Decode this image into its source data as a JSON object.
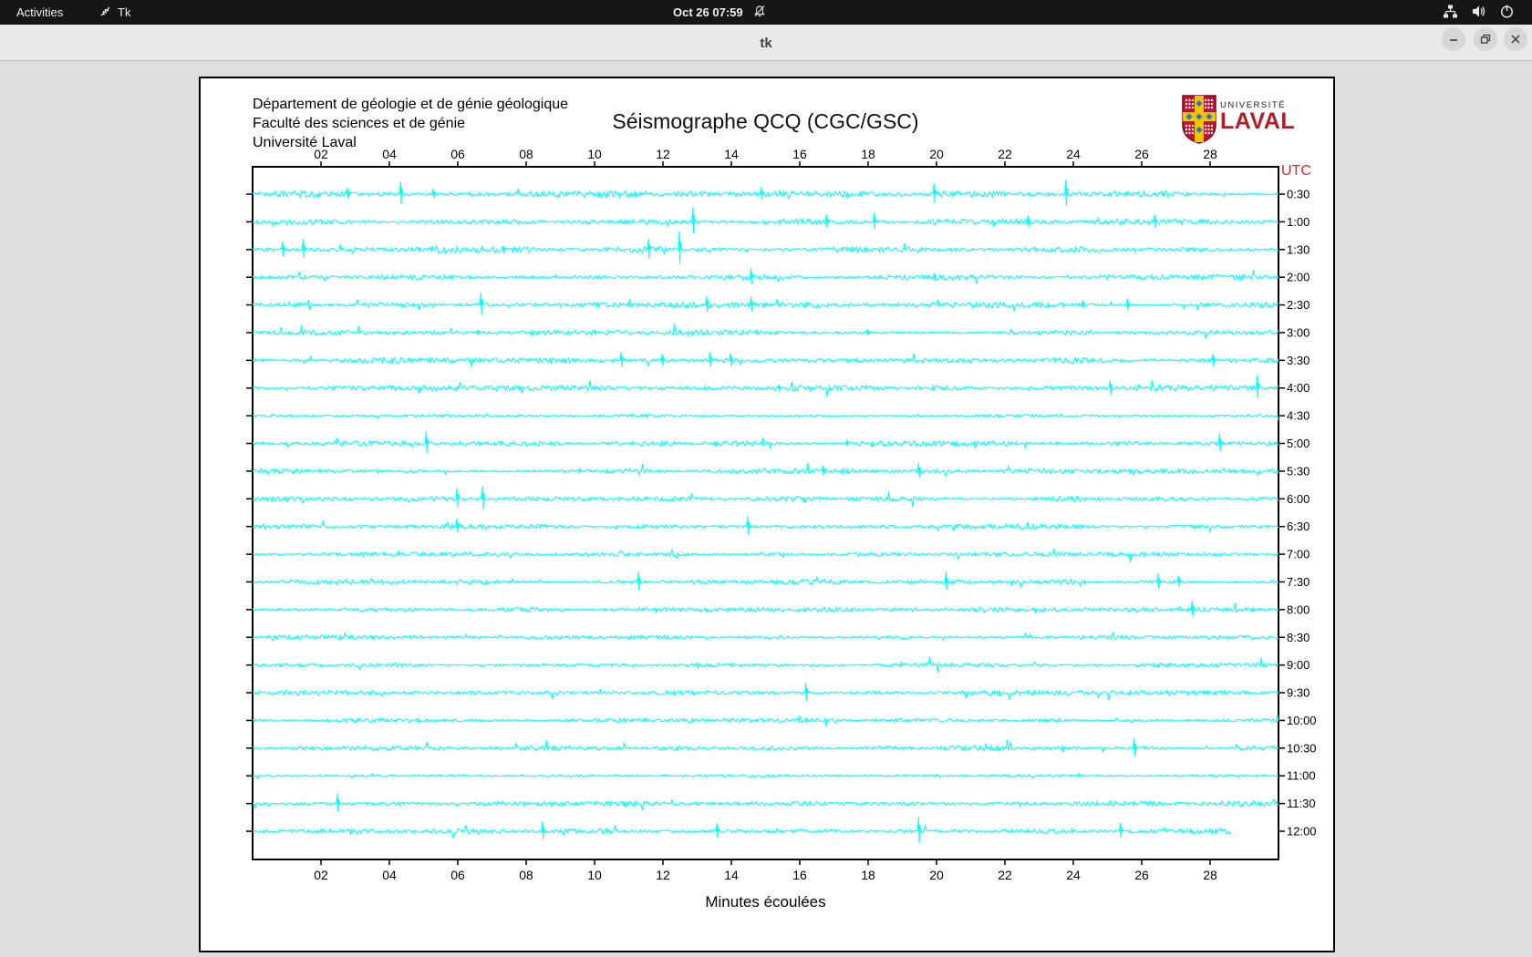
{
  "top_bar": {
    "activities": "Activities",
    "app_name": "Tk",
    "clock": "Oct 26  07:59"
  },
  "window": {
    "title": "tk"
  },
  "icons": {
    "top_bar_left": [
      "tk-app-icon"
    ],
    "top_bar_center": [
      "bell-slash-icon"
    ],
    "top_bar_right": [
      "network-icon",
      "volume-icon",
      "power-icon"
    ],
    "title_bar": [
      "minimize-icon",
      "restore-icon",
      "close-icon"
    ]
  },
  "canvas": {
    "header": {
      "line1": "Département de géologie et de génie géologique",
      "line2": "Faculté des sciences et de génie",
      "line3": "Université Laval"
    },
    "logo": {
      "line1": "UNIVERSITÉ",
      "line2": "LAVAL",
      "red": "#b01f27"
    }
  },
  "chart_data": {
    "type": "line",
    "title": "Séismographe QCQ (CGC/GSC)",
    "xlabel": "Minutes écoulées",
    "right_axis_label": "UTC",
    "x_range_minutes": [
      0,
      30
    ],
    "x_ticks": [
      "02",
      "04",
      "06",
      "08",
      "10",
      "12",
      "14",
      "16",
      "18",
      "20",
      "22",
      "24",
      "26",
      "28"
    ],
    "grid": false,
    "trace_color": "#00ffff",
    "axis_color": "#000000",
    "utc_color": "#e82222",
    "rows": [
      {
        "label": "0:30",
        "amp": 2.0,
        "spikes": [
          [
            2.8,
            7
          ],
          [
            4.35,
            14
          ],
          [
            5.3,
            6
          ],
          [
            14.9,
            8
          ],
          [
            19.95,
            12
          ],
          [
            23.8,
            16
          ]
        ]
      },
      {
        "label": "1:00",
        "amp": 1.8,
        "spikes": [
          [
            12.9,
            16
          ],
          [
            16.8,
            8
          ],
          [
            18.2,
            10
          ],
          [
            22.7,
            7
          ],
          [
            26.4,
            8
          ]
        ]
      },
      {
        "label": "1:30",
        "amp": 2.0,
        "spikes": [
          [
            0.9,
            9
          ],
          [
            1.5,
            11
          ],
          [
            7.35,
            4
          ],
          [
            11.6,
            12
          ],
          [
            12.5,
            20
          ]
        ]
      },
      {
        "label": "2:00",
        "amp": 1.6,
        "spikes": [
          [
            14.6,
            10
          ],
          [
            19.95,
            4
          ]
        ]
      },
      {
        "label": "2:30",
        "amp": 1.7,
        "spikes": [
          [
            6.7,
            14
          ],
          [
            13.3,
            10
          ],
          [
            14.6,
            9
          ],
          [
            24.3,
            5
          ],
          [
            25.6,
            7
          ]
        ]
      },
      {
        "label": "3:00",
        "amp": 1.6,
        "spikes": [
          [
            6.6,
            3
          ],
          [
            18.0,
            4
          ]
        ]
      },
      {
        "label": "3:30",
        "amp": 1.8,
        "spikes": [
          [
            10.8,
            9
          ],
          [
            12.0,
            7
          ],
          [
            13.4,
            9
          ],
          [
            14.0,
            8
          ],
          [
            28.1,
            7
          ]
        ]
      },
      {
        "label": "4:00",
        "amp": 1.7,
        "spikes": [
          [
            15.4,
            4
          ],
          [
            25.1,
            9
          ],
          [
            29.4,
            14
          ]
        ]
      },
      {
        "label": "4:30",
        "amp": 1.2,
        "spikes": []
      },
      {
        "label": "5:00",
        "amp": 1.5,
        "spikes": [
          [
            5.1,
            13
          ],
          [
            17.4,
            4
          ],
          [
            28.3,
            11
          ]
        ]
      },
      {
        "label": "5:30",
        "amp": 1.4,
        "spikes": [
          [
            16.7,
            6
          ],
          [
            19.5,
            9
          ]
        ]
      },
      {
        "label": "6:00",
        "amp": 1.5,
        "spikes": [
          [
            6.0,
            12
          ],
          [
            6.75,
            14
          ]
        ]
      },
      {
        "label": "6:30",
        "amp": 1.5,
        "spikes": [
          [
            6.0,
            9
          ],
          [
            14.5,
            11
          ]
        ]
      },
      {
        "label": "7:00",
        "amp": 1.3,
        "spikes": []
      },
      {
        "label": "7:30",
        "amp": 1.5,
        "spikes": [
          [
            11.3,
            11
          ],
          [
            20.3,
            11
          ],
          [
            26.5,
            9
          ],
          [
            27.1,
            7
          ]
        ]
      },
      {
        "label": "8:00",
        "amp": 1.4,
        "spikes": [
          [
            27.5,
            10
          ]
        ]
      },
      {
        "label": "8:30",
        "amp": 1.3,
        "spikes": []
      },
      {
        "label": "9:00",
        "amp": 1.2,
        "spikes": []
      },
      {
        "label": "9:30",
        "amp": 1.4,
        "spikes": [
          [
            16.2,
            11
          ]
        ]
      },
      {
        "label": "10:00",
        "amp": 1.2,
        "spikes": []
      },
      {
        "label": "10:30",
        "amp": 1.4,
        "spikes": [
          [
            25.8,
            11
          ]
        ]
      },
      {
        "label": "11:00",
        "amp": 0.7,
        "spikes": []
      },
      {
        "label": "11:30",
        "amp": 1.4,
        "spikes": [
          [
            2.5,
            11
          ]
        ]
      },
      {
        "label": "12:00",
        "amp": 1.5,
        "end_min": 28.6,
        "spikes": [
          [
            8.5,
            11
          ],
          [
            13.6,
            9
          ],
          [
            19.5,
            16
          ],
          [
            25.4,
            9
          ]
        ]
      }
    ]
  }
}
